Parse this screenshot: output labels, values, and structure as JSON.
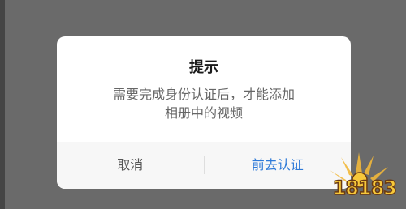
{
  "dialog": {
    "title": "提示",
    "message_line1": "需要完成身份认证后，才能添加",
    "message_line2": "相册中的视频",
    "cancel_label": "取消",
    "confirm_label": "前去认证"
  },
  "watermark": {
    "text": "18183"
  },
  "colors": {
    "overlay": "#6a6a6a",
    "dialog_bg": "#ffffff",
    "actions_bg": "#f7f7f7",
    "confirm_text": "#2e7ad8",
    "cancel_text": "#555555"
  }
}
